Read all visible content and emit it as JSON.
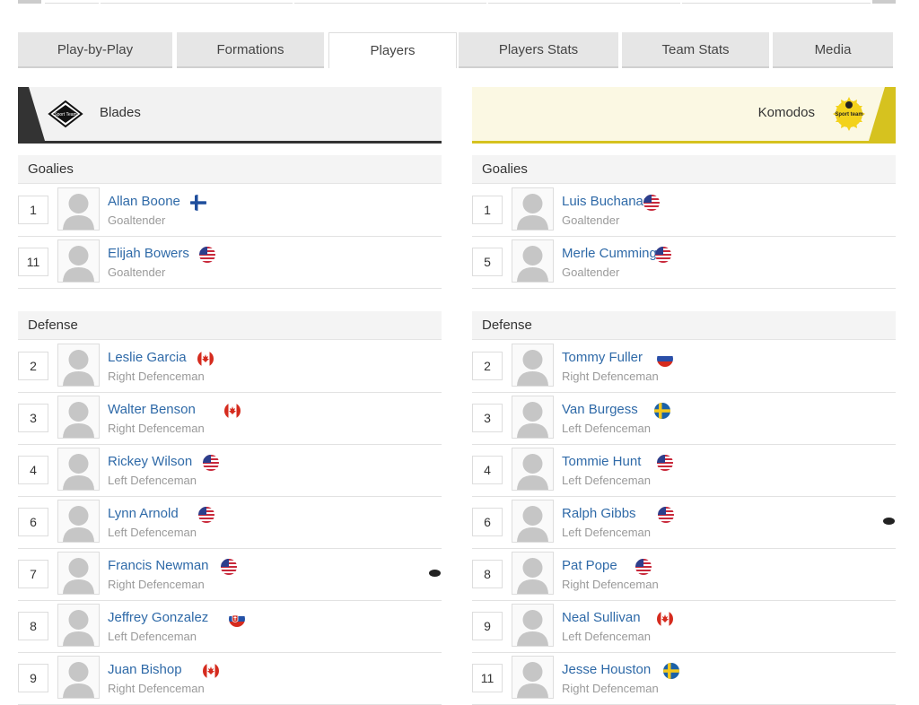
{
  "tabs": [
    "Play-by-Play",
    "Formations",
    "Players",
    "Players Stats",
    "Team Stats",
    "Media"
  ],
  "active_tab": "Players",
  "teams": {
    "home": {
      "name": "Blades",
      "logo_text": "Sport Team",
      "sections": [
        {
          "title": "Goalies",
          "players": [
            {
              "number": "1",
              "name": "Allan Boone",
              "position": "Goaltender",
              "flag": "finland"
            },
            {
              "number": "11",
              "name": "Elijah Bowers",
              "position": "Goaltender",
              "flag": "usa"
            }
          ]
        },
        {
          "title": "Defense",
          "players": [
            {
              "number": "2",
              "name": "Leslie Garcia",
              "position": "Right Defenceman",
              "flag": "canada"
            },
            {
              "number": "3",
              "name": "Walter Benson",
              "position": "Right Defenceman",
              "flag": "canada"
            },
            {
              "number": "4",
              "name": "Rickey Wilson",
              "position": "Left Defenceman",
              "flag": "usa"
            },
            {
              "number": "6",
              "name": "Lynn Arnold",
              "position": "Left Defenceman",
              "flag": "usa"
            },
            {
              "number": "7",
              "name": "Francis Newman",
              "position": "Right Defenceman",
              "flag": "usa",
              "puck": true
            },
            {
              "number": "8",
              "name": "Jeffrey Gonzalez",
              "position": "Left Defenceman",
              "flag": "slovakia"
            },
            {
              "number": "9",
              "name": "Juan Bishop",
              "position": "Right Defenceman",
              "flag": "canada"
            }
          ]
        }
      ]
    },
    "away": {
      "name": "Komodos",
      "logo_text": "Sport team",
      "sections": [
        {
          "title": "Goalies",
          "players": [
            {
              "number": "1",
              "name": "Luis Buchanan",
              "position": "Goaltender",
              "flag": "usa"
            },
            {
              "number": "5",
              "name": "Merle Cummings",
              "position": "Goaltender",
              "flag": "usa"
            }
          ]
        },
        {
          "title": "Defense",
          "players": [
            {
              "number": "2",
              "name": "Tommy Fuller",
              "position": "Right Defenceman",
              "flag": "russia"
            },
            {
              "number": "3",
              "name": "Van Burgess",
              "position": "Left Defenceman",
              "flag": "sweden"
            },
            {
              "number": "4",
              "name": "Tommie Hunt",
              "position": "Left Defenceman",
              "flag": "usa"
            },
            {
              "number": "6",
              "name": "Ralph Gibbs",
              "position": "Left Defenceman",
              "flag": "usa",
              "puck": true
            },
            {
              "number": "8",
              "name": "Pat Pope",
              "position": "Right Defenceman",
              "flag": "usa"
            },
            {
              "number": "9",
              "name": "Neal Sullivan",
              "position": "Left Defenceman",
              "flag": "canada"
            },
            {
              "number": "11",
              "name": "Jesse Houston",
              "position": "Right Defenceman",
              "flag": "sweden"
            }
          ]
        }
      ]
    }
  },
  "colors": {
    "link": "#2f6aa8",
    "home_accent": "#333333",
    "away_accent": "#d6c21f",
    "away_logo": "#f3d21b"
  }
}
